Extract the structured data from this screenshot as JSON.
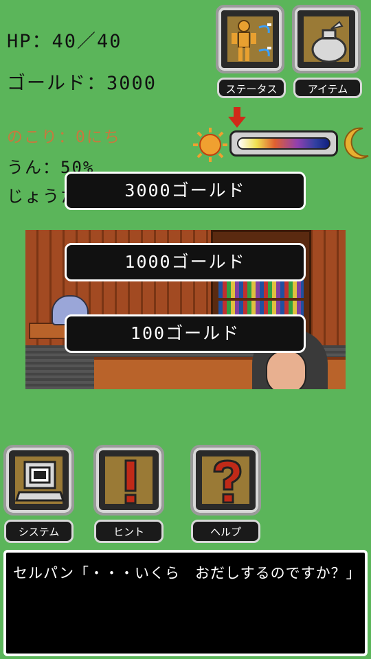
{
  "stats": {
    "hp": "HP：40／40",
    "gold": "ゴールド：3000",
    "days_left": "のこり：0にち",
    "luck": "うん：50%",
    "info": "じょうた"
  },
  "top_buttons": {
    "status_label": "ステータス",
    "item_label": "アイテム"
  },
  "choices": [
    {
      "label": "3000ゴールド"
    },
    {
      "label": "1000ゴールド"
    },
    {
      "label": "100ゴールド"
    }
  ],
  "bottom_buttons": {
    "system_label": "システム",
    "hint_label": "ヒント",
    "help_label": "ヘルプ"
  },
  "message": {
    "text": "セルパン「・・・いくら　おだしするのですか？」"
  },
  "icons": {
    "status": "person-figure-icon",
    "item": "bag-icon",
    "system": "computer-icon",
    "hint": "exclamation-icon",
    "help": "question-mark-icon",
    "sun": "sun-icon",
    "moon": "moon-icon"
  },
  "colors": {
    "background": "#5bb55a",
    "days_text": "#c8793e",
    "button_face": "#9a7a36",
    "hint_mark": "#c02a18"
  }
}
